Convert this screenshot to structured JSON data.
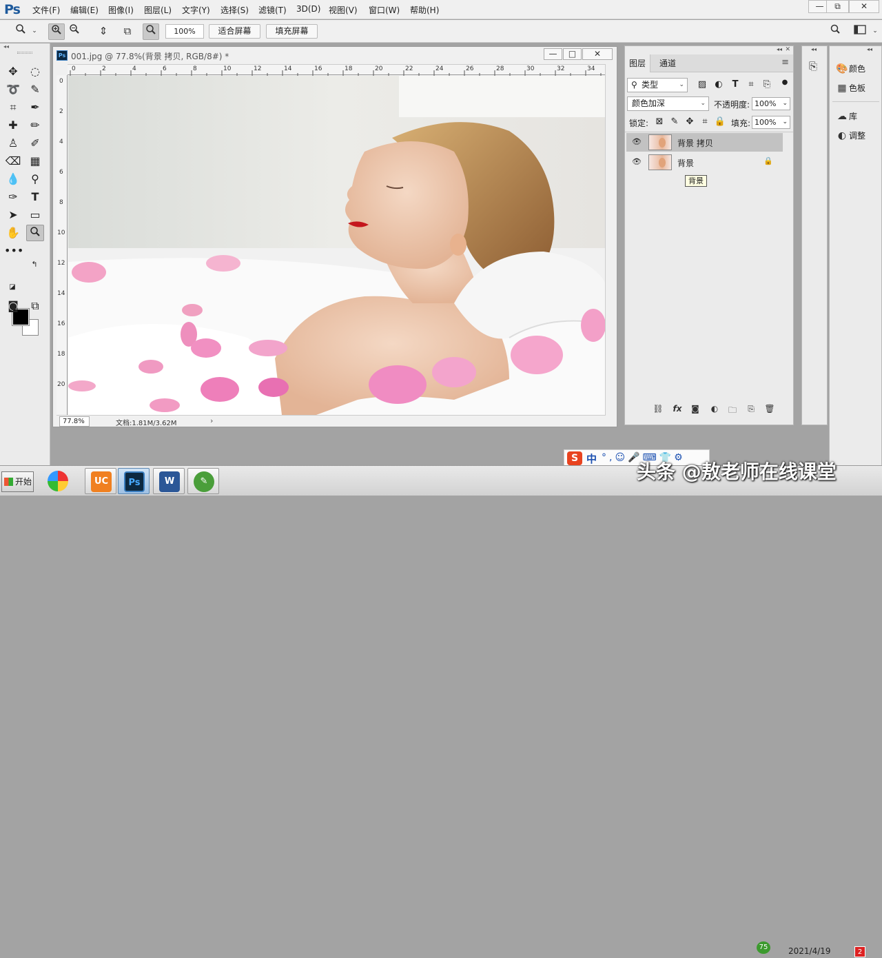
{
  "app": {
    "logo": "Ps"
  },
  "menu": [
    "文件(F)",
    "编辑(E)",
    "图像(I)",
    "图层(L)",
    "文字(Y)",
    "选择(S)",
    "滤镜(T)",
    "3D(D)",
    "视图(V)",
    "窗口(W)",
    "帮助(H)"
  ],
  "window_controls": {
    "minimize": "—",
    "restore": "⧉",
    "close": "✕"
  },
  "options_bar": {
    "zoom_value": "100%",
    "fit_screen": "适合屏幕",
    "fill_screen": "填充屏幕"
  },
  "document": {
    "tab_icon": "Ps",
    "title": "001.jpg @ 77.8%(背景 拷贝, RGB/8#) *",
    "ruler_top": [
      "0",
      "2",
      "4",
      "6",
      "8",
      "10",
      "12",
      "14",
      "16",
      "18",
      "20",
      "22",
      "24",
      "26",
      "28",
      "30",
      "32",
      "34"
    ],
    "ruler_left": [
      "0",
      "2",
      "4",
      "6",
      "8",
      "10",
      "12",
      "14",
      "16",
      "18",
      "20"
    ],
    "zoom": "77.8%",
    "info": "文档:1.81M/3.62M",
    "info_arrow": "›"
  },
  "layers_panel": {
    "tabs": [
      "图层",
      "通道"
    ],
    "filter_label": "类型",
    "blend_mode": "颜色加深",
    "opacity_label": "不透明度:",
    "opacity_value": "100%",
    "lock_label": "锁定:",
    "fill_label": "填充:",
    "fill_value": "100%",
    "layers": [
      {
        "name": "背景 拷贝",
        "selected": true,
        "locked": false
      },
      {
        "name": "背景",
        "selected": false,
        "locked": true
      }
    ],
    "tooltip": "背景"
  },
  "right_panels": [
    {
      "label": "颜色",
      "icon": "palette-icon"
    },
    {
      "label": "色板",
      "icon": "grid-icon"
    },
    {
      "label": "库",
      "icon": "cc-libraries-icon"
    },
    {
      "label": "调整",
      "icon": "adjustments-icon"
    }
  ],
  "taskbar": {
    "start": "开始",
    "apps": [
      "chrome-like-icon",
      "uc-browser-icon",
      "photoshop-icon",
      "word-icon",
      "green-app-icon"
    ],
    "ime": {
      "logo": "S",
      "mode": "中"
    },
    "watermark": "头条 @敖老师在线课堂",
    "tray_number": "75",
    "date": "2021/4/19",
    "badge": "2"
  }
}
